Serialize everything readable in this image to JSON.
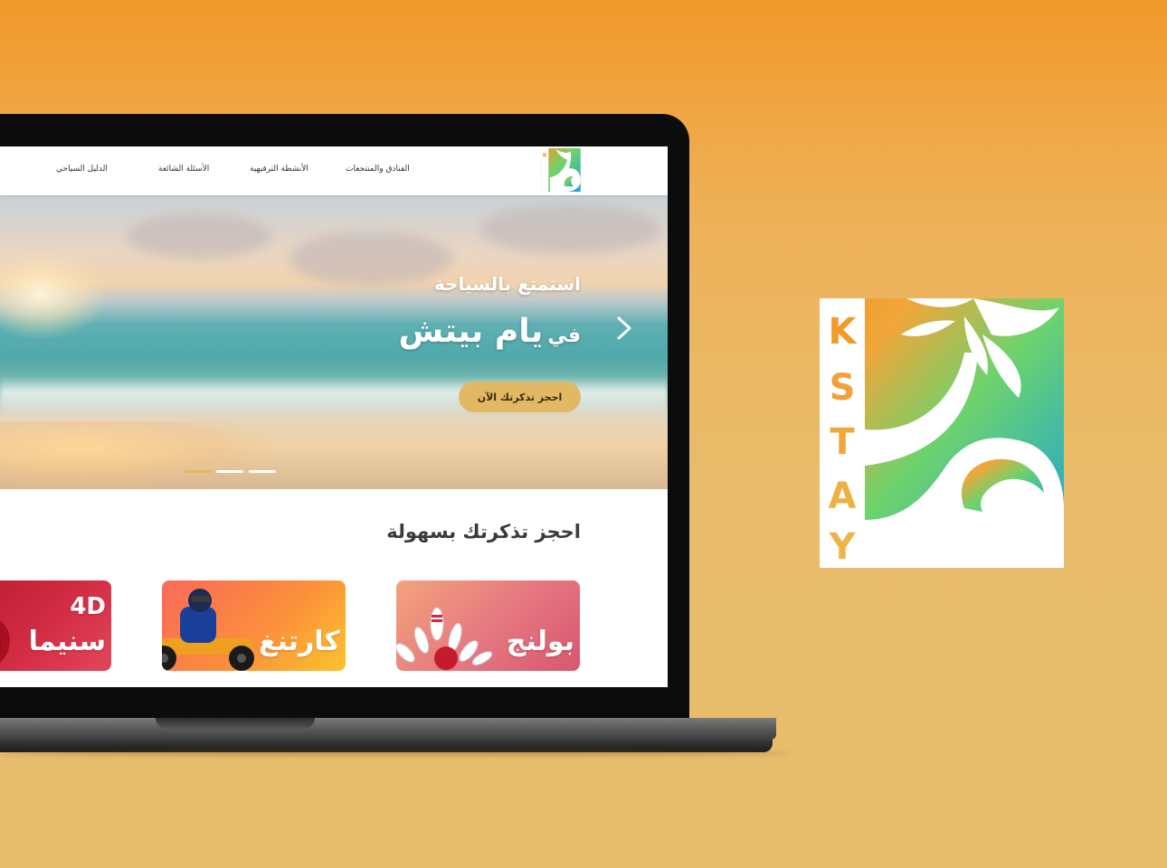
{
  "nav": {
    "links": [
      "الفنادق والمنتجعات",
      "الأنشطة الترفيهية",
      "الأسئلة الشائعة",
      "الدليل السياحي"
    ]
  },
  "logo": {
    "letters": [
      "K",
      "S",
      "T",
      "A",
      "Y"
    ]
  },
  "hero": {
    "subtitle": "استمتع بالسياحة",
    "title_prefix": "في",
    "title_main": "يام بيتش",
    "cta_label": "احجز تذكرتك الآن",
    "slide_count": 3,
    "active_slide": 1
  },
  "booking": {
    "title": "احجز تذكرتك بسهولة",
    "cards": [
      {
        "label": "بولنج"
      },
      {
        "label": "كارتنغ"
      },
      {
        "label": "سنيما",
        "badge": "4D"
      }
    ]
  },
  "colors": {
    "accent": "#e2b865",
    "background_top": "#f2992b",
    "background_bottom": "#e6bd6c"
  },
  "icons": {
    "next_arrow": "chevron-right-icon"
  }
}
